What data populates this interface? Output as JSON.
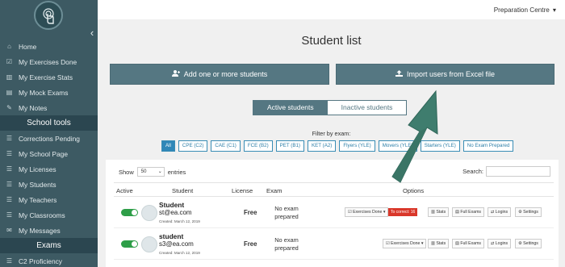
{
  "sidebar": {
    "items": [
      {
        "label": "Home",
        "icon": "home-icon",
        "glyph": "⌂"
      },
      {
        "label": "My Exercises Done",
        "icon": "checkbox-icon",
        "glyph": "☑"
      },
      {
        "label": "My Exercise Stats",
        "icon": "bar-chart-icon",
        "glyph": "▥"
      },
      {
        "label": "My Mock Exams",
        "icon": "document-icon",
        "glyph": "▤"
      },
      {
        "label": "My Notes",
        "icon": "edit-icon",
        "glyph": "✎"
      }
    ],
    "section_school": "School tools",
    "school_items": [
      {
        "label": "Corrections Pending",
        "icon": "list-icon",
        "glyph": "☰"
      },
      {
        "label": "My School Page",
        "icon": "list-icon",
        "glyph": "☰"
      },
      {
        "label": "My Licenses",
        "icon": "list-icon",
        "glyph": "☰"
      },
      {
        "label": "My Students",
        "icon": "users-icon",
        "glyph": "☰"
      },
      {
        "label": "My Teachers",
        "icon": "users-icon",
        "glyph": "☰"
      },
      {
        "label": "My Classrooms",
        "icon": "users-icon",
        "glyph": "☰"
      },
      {
        "label": "My Messages",
        "icon": "mail-icon",
        "glyph": "✉"
      }
    ],
    "section_exams": "Exams",
    "exam_items": [
      {
        "label": "C2 Proficiency",
        "icon": "list-icon",
        "glyph": "☰"
      }
    ]
  },
  "topbar": {
    "centre_name": "Preparation Centre",
    "caret": "▾"
  },
  "main": {
    "title": "Student list",
    "add_button": "Add one or more students",
    "import_button": "Import users from Excel file",
    "tab_active": "Active students",
    "tab_inactive": "Inactive students",
    "filter_label": "Filter by exam:",
    "filters": [
      "All",
      "CPE (C2)",
      "CAE (C1)",
      "FCE (B2)",
      "PET (B1)",
      "KET (A2)",
      "Flyers (YLE)",
      "Movers (YLE)",
      "Starters (YLE)",
      "No Exam Prepared"
    ]
  },
  "table": {
    "show_label": "Show",
    "entries_value": "50",
    "entries_label": "entries",
    "search_label": "Search:",
    "headers": {
      "active": "Active",
      "student": "Student",
      "license": "License",
      "exam": "Exam",
      "options": "Options"
    },
    "rows": [
      {
        "name": "Student",
        "email": "st@ea.com",
        "created": "Created: March 12, 2019",
        "license": "Free",
        "exam": "No exam prepared",
        "exercises": "Exercises Done",
        "to_correct": "To correct: 16",
        "stats": "Stats",
        "full_exams": "Full Exams",
        "logins": "Logins",
        "settings": "Settings"
      },
      {
        "name": "student",
        "email": "s3@ea.com",
        "created": "Created: March 12, 2019",
        "license": "Free",
        "exam": "No exam prepared",
        "exercises": "Exercises Done",
        "to_correct": "",
        "stats": "Stats",
        "full_exams": "Full Exams",
        "logins": "Logins",
        "settings": "Settings"
      }
    ]
  },
  "colors": {
    "sidebar": "#3d5a63",
    "button": "#557782",
    "accent_blue": "#2f87b8",
    "toggle_green": "#2e9e48",
    "arrow": "#3f7d6e"
  }
}
